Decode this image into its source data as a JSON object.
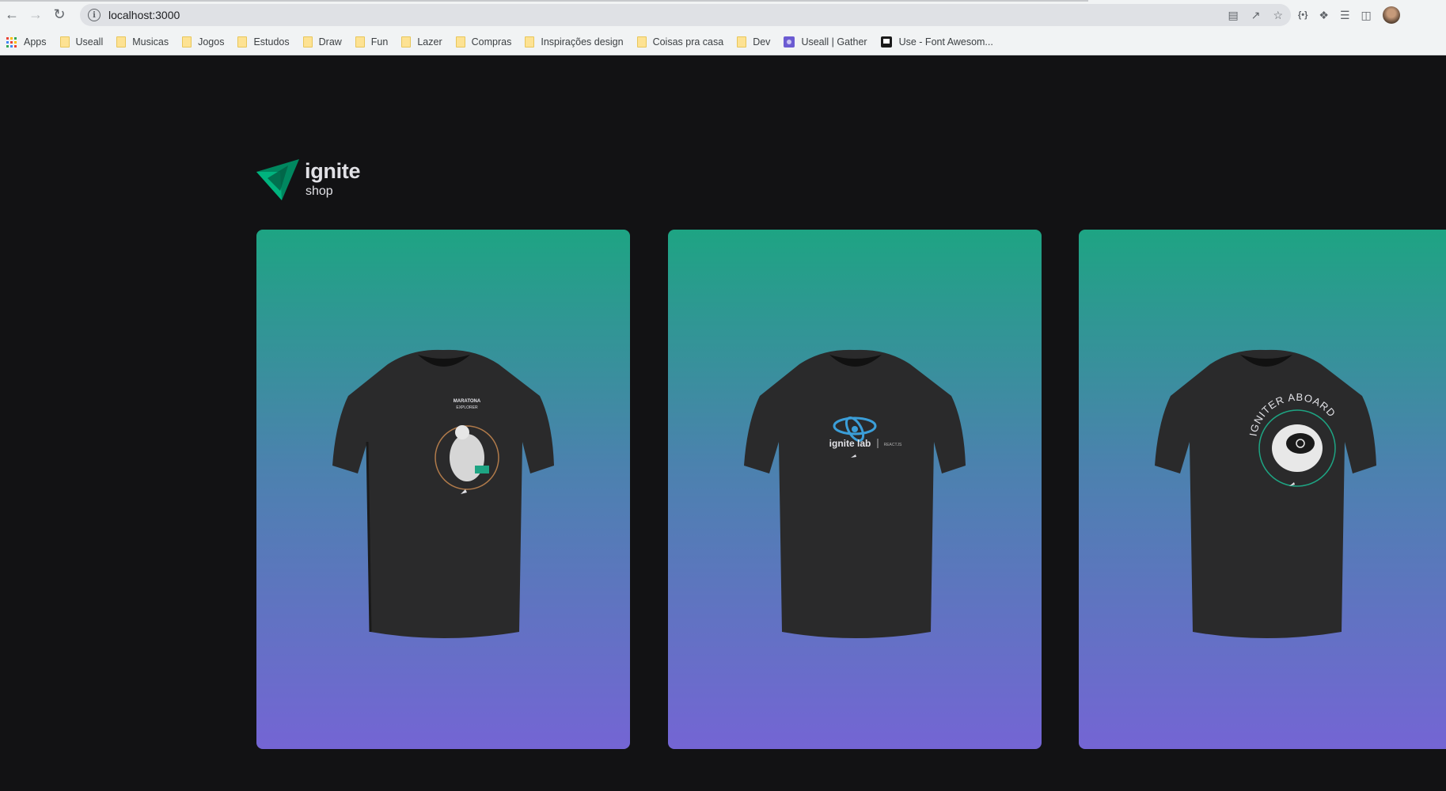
{
  "browser": {
    "url": "localhost:3000",
    "bookmarks": [
      {
        "label": "Apps",
        "icon": "apps-grid-icon"
      },
      {
        "label": "Useall",
        "icon": "folder-icon"
      },
      {
        "label": "Musicas",
        "icon": "folder-icon"
      },
      {
        "label": "Jogos",
        "icon": "folder-icon"
      },
      {
        "label": "Estudos",
        "icon": "folder-icon"
      },
      {
        "label": "Draw",
        "icon": "folder-icon"
      },
      {
        "label": "Fun",
        "icon": "folder-icon"
      },
      {
        "label": "Lazer",
        "icon": "folder-icon"
      },
      {
        "label": "Compras",
        "icon": "folder-icon"
      },
      {
        "label": "Inspirações design",
        "icon": "folder-icon"
      },
      {
        "label": "Coisas pra casa",
        "icon": "folder-icon"
      },
      {
        "label": "Dev",
        "icon": "folder-icon"
      },
      {
        "label": "Useall | Gather",
        "icon": "gather-icon"
      },
      {
        "label": "Use - Font Awesom...",
        "icon": "font-awesome-icon"
      }
    ]
  },
  "header": {
    "logo_title": "ignite",
    "logo_subtitle": "shop"
  },
  "products": [
    {
      "name": "Maratona Explorer t-shirt",
      "print_text_top": "MARATONA",
      "print_text_bottom": "EXPLORER"
    },
    {
      "name": "Ignite Lab t-shirt",
      "print_text": "ignite lab",
      "print_sub": "REACTJS"
    },
    {
      "name": "Igniter Abord t-shirt",
      "print_text": "IGNITER ABOARD"
    }
  ],
  "colors": {
    "page_bg": "#121214",
    "gradient_top": "#1ea483",
    "gradient_bottom": "#7465d4",
    "brand_green": "#00875f",
    "text": "#e1e1e6"
  }
}
